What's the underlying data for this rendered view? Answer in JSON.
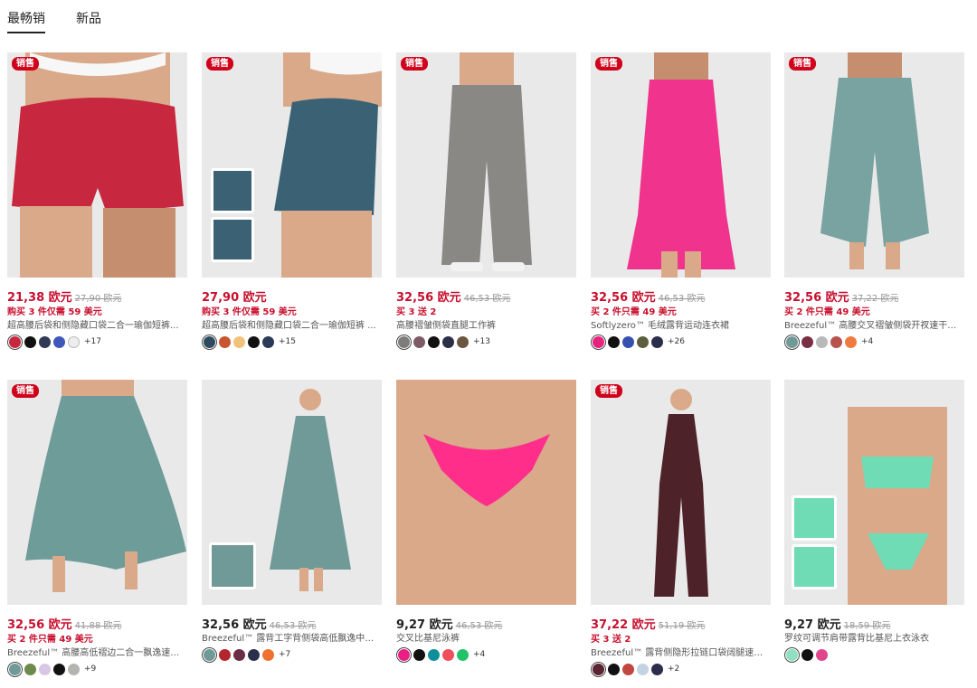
{
  "tabs": [
    {
      "label": "最畅销",
      "active": true
    },
    {
      "label": "新品",
      "active": false
    }
  ],
  "badge_label": "销售",
  "products": [
    {
      "price": "21,38 欧元",
      "old": "27,90 欧元",
      "promo": "购买 3 件仅需 59 美元",
      "name": "超高腰后袋和侧隐藏口袋二合一瑜伽短裤...",
      "badge": true,
      "sale": true,
      "swatches": [
        "#c7283f",
        "#111111",
        "#2f3a55",
        "#3f57b8",
        "#eeeeee"
      ],
      "more": "+17",
      "garment": "shorts",
      "main": "#c7283f"
    },
    {
      "price": "27,90 欧元",
      "old": "",
      "promo": "购买 3 件仅需 59 美元",
      "name": "超高腰后袋和侧隐藏口袋二合一瑜伽短裤 ...",
      "badge": true,
      "sale": true,
      "swatches": [
        "#2e4a5e",
        "#c8552f",
        "#f2c17a",
        "#111111",
        "#2b3a58"
      ],
      "more": "+15",
      "garment": "shorts2",
      "main": "#3a6274"
    },
    {
      "price": "32,56 欧元",
      "old": "46,53 欧元",
      "promo": "买 3 送 2",
      "name": "高腰褶皱侧袋直腿工作裤",
      "badge": true,
      "sale": true,
      "swatches": [
        "#7c7c7a",
        "#7e5a66",
        "#111111",
        "#2a2f45",
        "#6b5640"
      ],
      "more": "+13",
      "garment": "pants",
      "main": "#8a8885"
    },
    {
      "price": "32,56 欧元",
      "old": "46,53 欧元",
      "promo": "买 2 件只需 49 美元",
      "name": "Softlyzero™ 毛绒露背运动连衣裙",
      "badge": true,
      "sale": true,
      "swatches": [
        "#e8237e",
        "#111111",
        "#3650b0",
        "#5b5f3e",
        "#2a2e4a"
      ],
      "more": "+26",
      "garment": "dress",
      "main": "#f0338d"
    },
    {
      "price": "32,56 欧元",
      "old": "37,22 欧元",
      "promo": "买 2 件只需 49 美元",
      "name": "Breezeful™ 高腰交叉褶皱侧袋开衩速干度...",
      "badge": true,
      "sale": true,
      "swatches": [
        "#6f9a98",
        "#7a2e44",
        "#b9b9b9",
        "#b8524d",
        "#ef7a3f"
      ],
      "more": "+4",
      "garment": "culottes",
      "main": "#79a3a0"
    },
    {
      "price": "32,56 欧元",
      "old": "41,88 欧元",
      "promo": "买 2 件只需 49 美元",
      "name": "Breezeful™ 高腰高低褶边二合一飘逸速干...",
      "badge": true,
      "sale": true,
      "swatches": [
        "#6f9a98",
        "#6c8a4e",
        "#d8c7e4",
        "#111111",
        "#b5b5b0"
      ],
      "more": "+9",
      "garment": "skirt",
      "main": "#6d9c99"
    },
    {
      "price": "32,56 欧元",
      "old": "46,53 欧元",
      "promo": "",
      "name": "Breezeful™ 露背工字背侧袋高低飘逸中长...",
      "badge": false,
      "sale": false,
      "swatches": [
        "#6f9a98",
        "#b3262d",
        "#6b2d45",
        "#2b2f4b",
        "#f0712f"
      ],
      "more": "+7",
      "garment": "longdress",
      "main": "#6f9a98"
    },
    {
      "price": "9,27 欧元",
      "old": "46,53 欧元",
      "promo": "",
      "name": "交叉比基尼泳裤",
      "badge": false,
      "sale": false,
      "swatches": [
        "#ea1f86",
        "#111111",
        "#0f8f9a",
        "#f04e5a",
        "#22c26a"
      ],
      "more": "+4",
      "garment": "bikini",
      "main": "#ff2e8b"
    },
    {
      "price": "37,22 欧元",
      "old": "51,19 欧元",
      "promo": "买 3 送 2",
      "name": "Breezeful™ 露背侧隐形拉链口袋阔腿速干...",
      "badge": true,
      "sale": true,
      "swatches": [
        "#5a2430",
        "#111111",
        "#c0463f",
        "#c2d3e2",
        "#2a2e4a"
      ],
      "more": "+2",
      "garment": "jumpsuit",
      "main": "#4d2229"
    },
    {
      "price": "9,27 欧元",
      "old": "18,59 欧元",
      "promo": "",
      "name": "罗纹可调节肩带露背比基尼上衣泳衣",
      "badge": false,
      "sale": false,
      "swatches": [
        "#8fe0c0",
        "#111111",
        "#e0468c"
      ],
      "more": "",
      "garment": "bikinitop",
      "main": "#6fdcb6"
    }
  ]
}
